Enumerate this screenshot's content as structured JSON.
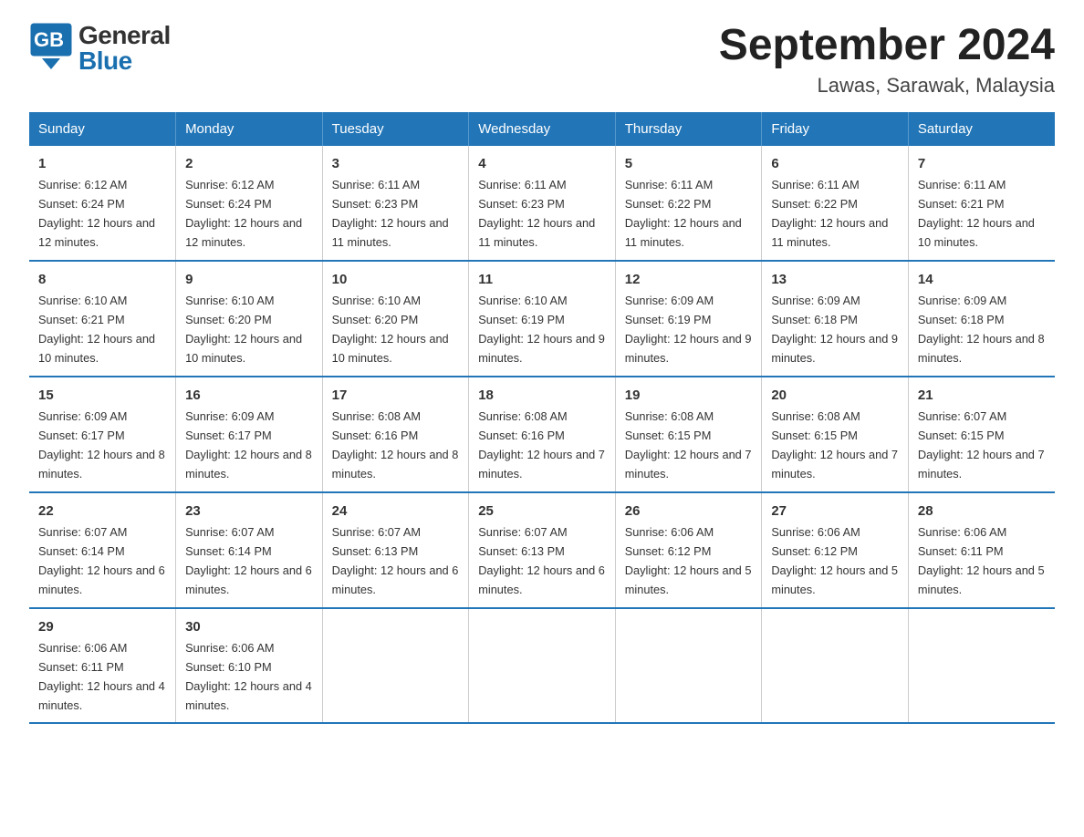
{
  "header": {
    "logo_general": "General",
    "logo_blue": "Blue",
    "title": "September 2024",
    "subtitle": "Lawas, Sarawak, Malaysia"
  },
  "days_of_week": [
    "Sunday",
    "Monday",
    "Tuesday",
    "Wednesday",
    "Thursday",
    "Friday",
    "Saturday"
  ],
  "weeks": [
    [
      {
        "day": "1",
        "sunrise": "6:12 AM",
        "sunset": "6:24 PM",
        "daylight": "12 hours and 12 minutes."
      },
      {
        "day": "2",
        "sunrise": "6:12 AM",
        "sunset": "6:24 PM",
        "daylight": "12 hours and 12 minutes."
      },
      {
        "day": "3",
        "sunrise": "6:11 AM",
        "sunset": "6:23 PM",
        "daylight": "12 hours and 11 minutes."
      },
      {
        "day": "4",
        "sunrise": "6:11 AM",
        "sunset": "6:23 PM",
        "daylight": "12 hours and 11 minutes."
      },
      {
        "day": "5",
        "sunrise": "6:11 AM",
        "sunset": "6:22 PM",
        "daylight": "12 hours and 11 minutes."
      },
      {
        "day": "6",
        "sunrise": "6:11 AM",
        "sunset": "6:22 PM",
        "daylight": "12 hours and 11 minutes."
      },
      {
        "day": "7",
        "sunrise": "6:11 AM",
        "sunset": "6:21 PM",
        "daylight": "12 hours and 10 minutes."
      }
    ],
    [
      {
        "day": "8",
        "sunrise": "6:10 AM",
        "sunset": "6:21 PM",
        "daylight": "12 hours and 10 minutes."
      },
      {
        "day": "9",
        "sunrise": "6:10 AM",
        "sunset": "6:20 PM",
        "daylight": "12 hours and 10 minutes."
      },
      {
        "day": "10",
        "sunrise": "6:10 AM",
        "sunset": "6:20 PM",
        "daylight": "12 hours and 10 minutes."
      },
      {
        "day": "11",
        "sunrise": "6:10 AM",
        "sunset": "6:19 PM",
        "daylight": "12 hours and 9 minutes."
      },
      {
        "day": "12",
        "sunrise": "6:09 AM",
        "sunset": "6:19 PM",
        "daylight": "12 hours and 9 minutes."
      },
      {
        "day": "13",
        "sunrise": "6:09 AM",
        "sunset": "6:18 PM",
        "daylight": "12 hours and 9 minutes."
      },
      {
        "day": "14",
        "sunrise": "6:09 AM",
        "sunset": "6:18 PM",
        "daylight": "12 hours and 8 minutes."
      }
    ],
    [
      {
        "day": "15",
        "sunrise": "6:09 AM",
        "sunset": "6:17 PM",
        "daylight": "12 hours and 8 minutes."
      },
      {
        "day": "16",
        "sunrise": "6:09 AM",
        "sunset": "6:17 PM",
        "daylight": "12 hours and 8 minutes."
      },
      {
        "day": "17",
        "sunrise": "6:08 AM",
        "sunset": "6:16 PM",
        "daylight": "12 hours and 8 minutes."
      },
      {
        "day": "18",
        "sunrise": "6:08 AM",
        "sunset": "6:16 PM",
        "daylight": "12 hours and 7 minutes."
      },
      {
        "day": "19",
        "sunrise": "6:08 AM",
        "sunset": "6:15 PM",
        "daylight": "12 hours and 7 minutes."
      },
      {
        "day": "20",
        "sunrise": "6:08 AM",
        "sunset": "6:15 PM",
        "daylight": "12 hours and 7 minutes."
      },
      {
        "day": "21",
        "sunrise": "6:07 AM",
        "sunset": "6:15 PM",
        "daylight": "12 hours and 7 minutes."
      }
    ],
    [
      {
        "day": "22",
        "sunrise": "6:07 AM",
        "sunset": "6:14 PM",
        "daylight": "12 hours and 6 minutes."
      },
      {
        "day": "23",
        "sunrise": "6:07 AM",
        "sunset": "6:14 PM",
        "daylight": "12 hours and 6 minutes."
      },
      {
        "day": "24",
        "sunrise": "6:07 AM",
        "sunset": "6:13 PM",
        "daylight": "12 hours and 6 minutes."
      },
      {
        "day": "25",
        "sunrise": "6:07 AM",
        "sunset": "6:13 PM",
        "daylight": "12 hours and 6 minutes."
      },
      {
        "day": "26",
        "sunrise": "6:06 AM",
        "sunset": "6:12 PM",
        "daylight": "12 hours and 5 minutes."
      },
      {
        "day": "27",
        "sunrise": "6:06 AM",
        "sunset": "6:12 PM",
        "daylight": "12 hours and 5 minutes."
      },
      {
        "day": "28",
        "sunrise": "6:06 AM",
        "sunset": "6:11 PM",
        "daylight": "12 hours and 5 minutes."
      }
    ],
    [
      {
        "day": "29",
        "sunrise": "6:06 AM",
        "sunset": "6:11 PM",
        "daylight": "12 hours and 4 minutes."
      },
      {
        "day": "30",
        "sunrise": "6:06 AM",
        "sunset": "6:10 PM",
        "daylight": "12 hours and 4 minutes."
      },
      null,
      null,
      null,
      null,
      null
    ]
  ]
}
